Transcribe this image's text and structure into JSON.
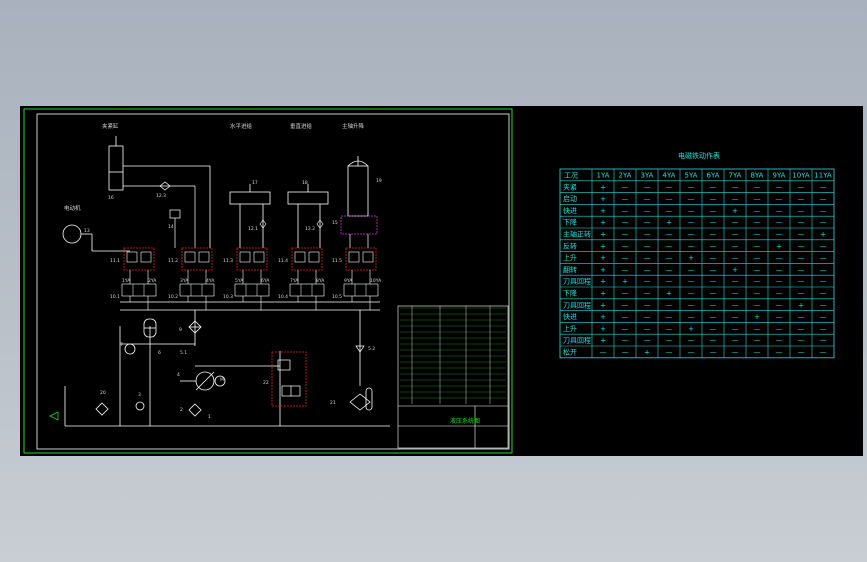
{
  "drawing": {
    "circuit_labels": {
      "clamp_cylinder": "夹紧缸",
      "motor": "电动机",
      "horizontal_feed": "水平进给",
      "vertical_feed": "垂直进给",
      "spindle_lift": "主轴升降"
    },
    "component_ids": [
      "16",
      "12.3",
      "14",
      "13",
      "17",
      "18",
      "19",
      "12.1",
      "12.2",
      "15",
      "11.1",
      "11.2",
      "11.3",
      "11.4",
      "11.5",
      "10.1",
      "10.2",
      "10.3",
      "10.4",
      "10.5",
      "9",
      "8",
      "7",
      "6",
      "5.1",
      "5.2",
      "4",
      "3",
      "2",
      "1",
      "20",
      "21",
      "22"
    ],
    "solenoid_labels": [
      "1YA",
      "2YA",
      "3YA",
      "4YA",
      "5YA",
      "6YA",
      "7YA",
      "8YA",
      "9YA",
      "10YA"
    ]
  },
  "table": {
    "title": "电磁铁动作表",
    "columns": [
      "工况",
      "1YA",
      "2YA",
      "3YA",
      "4YA",
      "5YA",
      "6YA",
      "7YA",
      "8YA",
      "9YA",
      "10YA",
      "11YA"
    ],
    "rows": [
      [
        "夹紧",
        "+",
        "—",
        "—",
        "—",
        "—",
        "—",
        "—",
        "—",
        "—",
        "—",
        "—"
      ],
      [
        "启动",
        "+",
        "—",
        "—",
        "—",
        "—",
        "—",
        "—",
        "—",
        "—",
        "—",
        "—"
      ],
      [
        "快进",
        "+",
        "—",
        "—",
        "—",
        "—",
        "—",
        "+",
        "—",
        "—",
        "—",
        "—"
      ],
      [
        "下降",
        "+",
        "—",
        "—",
        "+",
        "—",
        "—",
        "—",
        "—",
        "—",
        "—",
        "—"
      ],
      [
        "主轴正转",
        "+",
        "—",
        "—",
        "—",
        "—",
        "—",
        "—",
        "—",
        "—",
        "—",
        "+"
      ],
      [
        "反转",
        "+",
        "—",
        "—",
        "—",
        "—",
        "—",
        "—",
        "—",
        "+",
        "—",
        "—"
      ],
      [
        "上升",
        "+",
        "—",
        "—",
        "—",
        "+",
        "—",
        "—",
        "—",
        "—",
        "—",
        "—"
      ],
      [
        "翻转",
        "+",
        "—",
        "—",
        "—",
        "—",
        "—",
        "+",
        "—",
        "—",
        "—",
        "—"
      ],
      [
        "刀具回程",
        "+",
        "+",
        "—",
        "—",
        "—",
        "—",
        "—",
        "—",
        "—",
        "—",
        "—"
      ],
      [
        "下降",
        "+",
        "—",
        "—",
        "+",
        "—",
        "—",
        "—",
        "—",
        "—",
        "—",
        "—"
      ],
      [
        "刀具回程",
        "+",
        "—",
        "—",
        "—",
        "—",
        "—",
        "—",
        "—",
        "—",
        "+",
        "—"
      ],
      [
        "快进",
        "+",
        "—",
        "—",
        "—",
        "—",
        "—",
        "—",
        "+",
        "—",
        "—",
        "—"
      ],
      [
        "上升",
        "+",
        "—",
        "—",
        "—",
        "+",
        "—",
        "—",
        "—",
        "—",
        "—",
        "—"
      ],
      [
        "刀具回程",
        "+",
        "—",
        "—",
        "—",
        "—",
        "—",
        "—",
        "—",
        "—",
        "—",
        "—"
      ],
      [
        "松开",
        "—",
        "—",
        "+",
        "—",
        "—",
        "—",
        "—",
        "—",
        "—",
        "—",
        "—"
      ]
    ]
  },
  "titleblock": {
    "drawing_name": "液压系统图"
  },
  "colors": {
    "background": "#000000",
    "frame": "#ffffff",
    "outer_frame": "#22dd22",
    "table_lines": "#20e0e0",
    "valve_highlight": "#e02020",
    "spindle_valve_highlight": "#d030d0"
  }
}
